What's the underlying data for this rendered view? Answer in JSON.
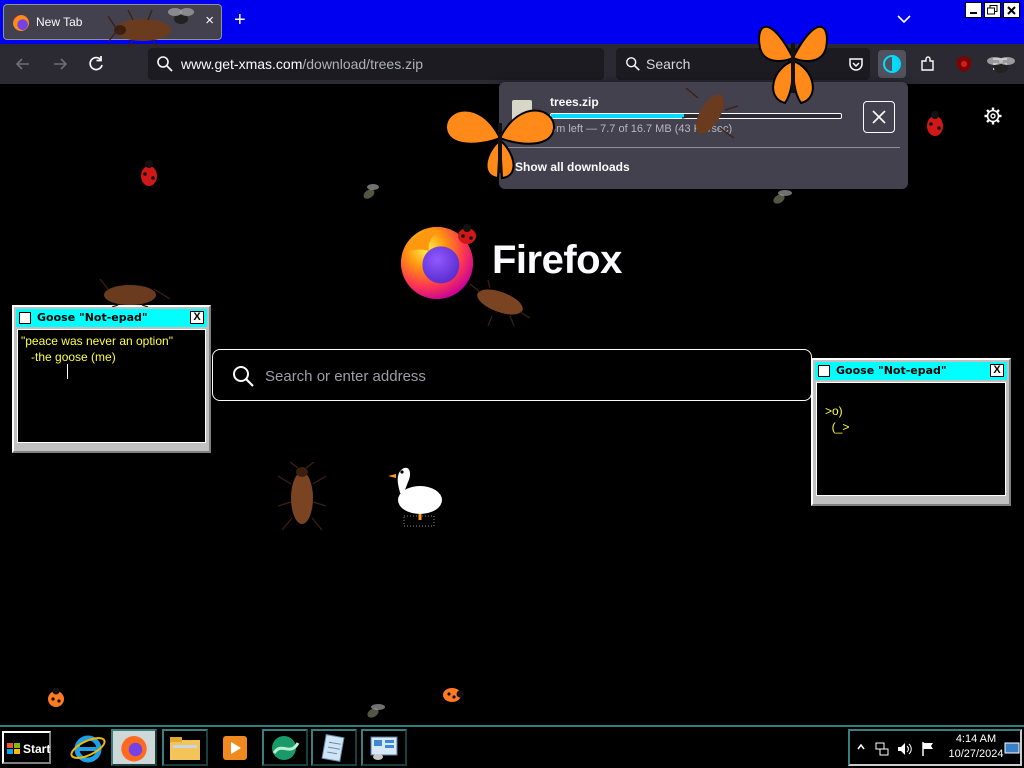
{
  "browser": {
    "tab": {
      "title": "New Tab",
      "close": "×"
    },
    "new_tab": "+",
    "url": {
      "domain": "www.get-xmas.com",
      "path": "/download/trees.zip"
    },
    "search_placeholder": "Search"
  },
  "downloads": {
    "filename": "trees.zip",
    "progress": 0.46,
    "status": "4m left — 7.7 of 16.7 MB (43 KB/sec)",
    "show_all": "Show all downloads"
  },
  "newtab": {
    "wordmark": "Firefox",
    "search_placeholder": "Search or enter address"
  },
  "goose_windows": [
    {
      "title": "Goose \"Not-epad\"",
      "text": "\"peace was never an option\"\n   -the goose (me)",
      "close": "X"
    },
    {
      "title": "Goose \"Not-epad\"",
      "text": ">o)\n  (_>",
      "close": "X"
    }
  ],
  "taskbar": {
    "start": "Start",
    "time": "4:14 AM",
    "date": "10/27/2024"
  },
  "colors": {
    "tabstrip": "#0000f0",
    "toolbar": "#2b2a33",
    "progress": "#00ddff",
    "goose_titlebar": "#00ffff",
    "goose_text": "#ffff40"
  }
}
